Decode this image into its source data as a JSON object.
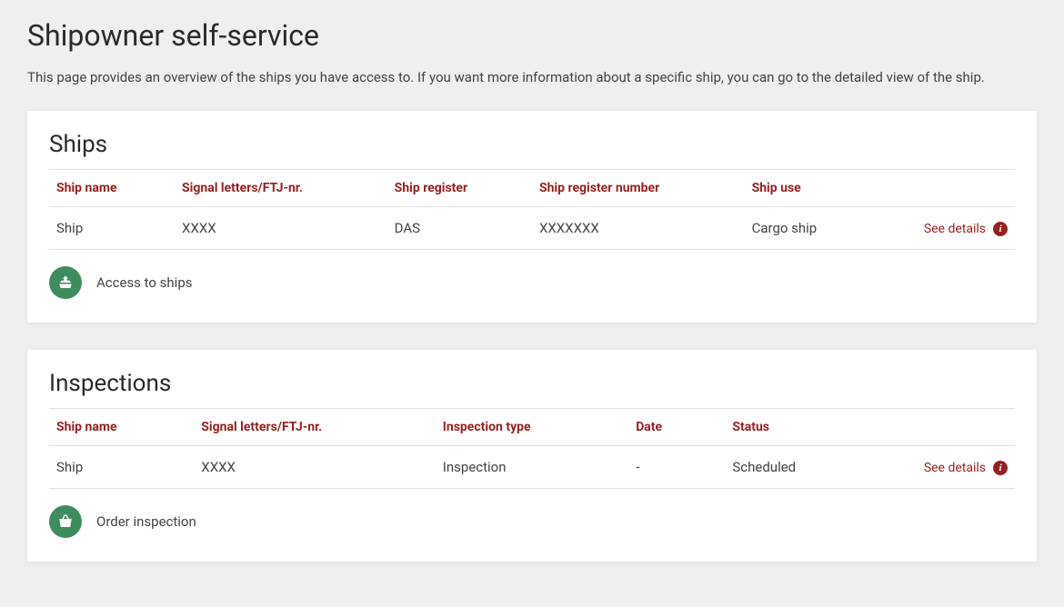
{
  "page": {
    "title": "Shipowner self-service",
    "description": "This page provides an overview of the ships you have access to. If you want more information about a specific ship, you can go to the detailed view of the ship."
  },
  "ships_section": {
    "title": "Ships",
    "columns": {
      "ship_name": "Ship name",
      "signal": "Signal letters/FTJ-nr.",
      "register": "Ship register",
      "register_number": "Ship register number",
      "use": "Ship use"
    },
    "row": {
      "ship_name": "Ship",
      "signal": "XXXX",
      "register": "DAS",
      "register_number": "XXXXXXX",
      "use": "Cargo ship",
      "details_label": "See details"
    },
    "action_label": "Access to ships"
  },
  "inspections_section": {
    "title": "Inspections",
    "columns": {
      "ship_name": "Ship name",
      "signal": "Signal letters/FTJ-nr.",
      "type": "Inspection type",
      "date": "Date",
      "status": "Status"
    },
    "row": {
      "ship_name": "Ship",
      "signal": "XXXX",
      "type": "Inspection",
      "date": "-",
      "status": "Scheduled",
      "details_label": "See details"
    },
    "action_label": "Order inspection"
  }
}
